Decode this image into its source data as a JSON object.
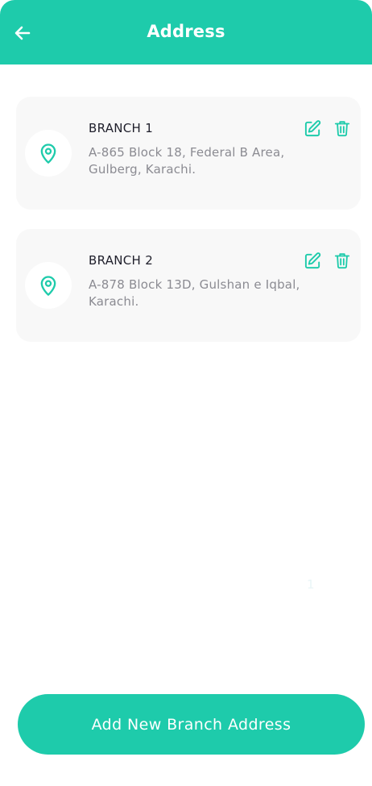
{
  "header": {
    "title": "Address",
    "back_icon": "arrow-left-icon",
    "background_color": "#1ecbab"
  },
  "branches": [
    {
      "name": "BRANCH 1",
      "address": "A-865 Block 18, Federal B Area, Gulberg, Karachi.",
      "icons": [
        "map-pin-icon",
        "edit-icon",
        "trash-icon"
      ]
    },
    {
      "name": "BRANCH 2",
      "address": "A-878 Block 13D, Gulshan e Iqbal, Karachi.",
      "icons": [
        "map-pin-icon",
        "edit-icon",
        "trash-icon"
      ]
    }
  ],
  "faint_label": "1",
  "footer": {
    "add_button_label": "Add New Branch Address"
  },
  "colors": {
    "accent": "#1ecbab",
    "card_background": "#f8f8f8",
    "title_text": "#1f1f2b",
    "secondary_text": "#8b8b92"
  }
}
